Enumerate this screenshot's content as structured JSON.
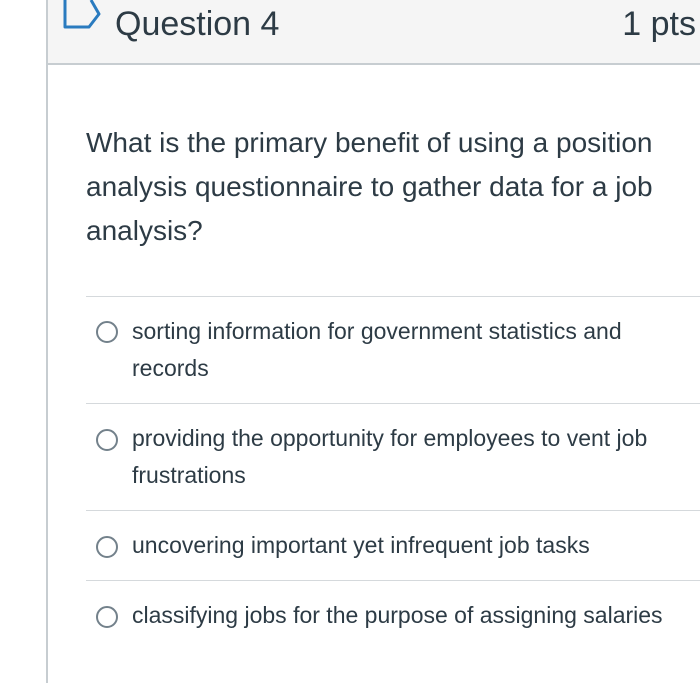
{
  "question": {
    "title": "Question 4",
    "points": "1 pts",
    "text": "What is the primary benefit of using a position analysis questionnaire to gather data for a job analysis?"
  },
  "answers": [
    {
      "label": "sorting information for government statistics and records"
    },
    {
      "label": "providing the opportunity for employees to vent job frustrations"
    },
    {
      "label": "uncovering important yet infrequent job tasks"
    },
    {
      "label": "classifying jobs for the purpose of assigning salaries"
    }
  ],
  "icons": {
    "flag": "flag-outline-icon",
    "radio": "radio-unchecked-icon"
  },
  "colors": {
    "text": "#2d3b45",
    "border": "#c7cdd1",
    "header_bg": "#f5f5f5",
    "radio_border": "#73818b",
    "flag": "#2a7bbf"
  }
}
